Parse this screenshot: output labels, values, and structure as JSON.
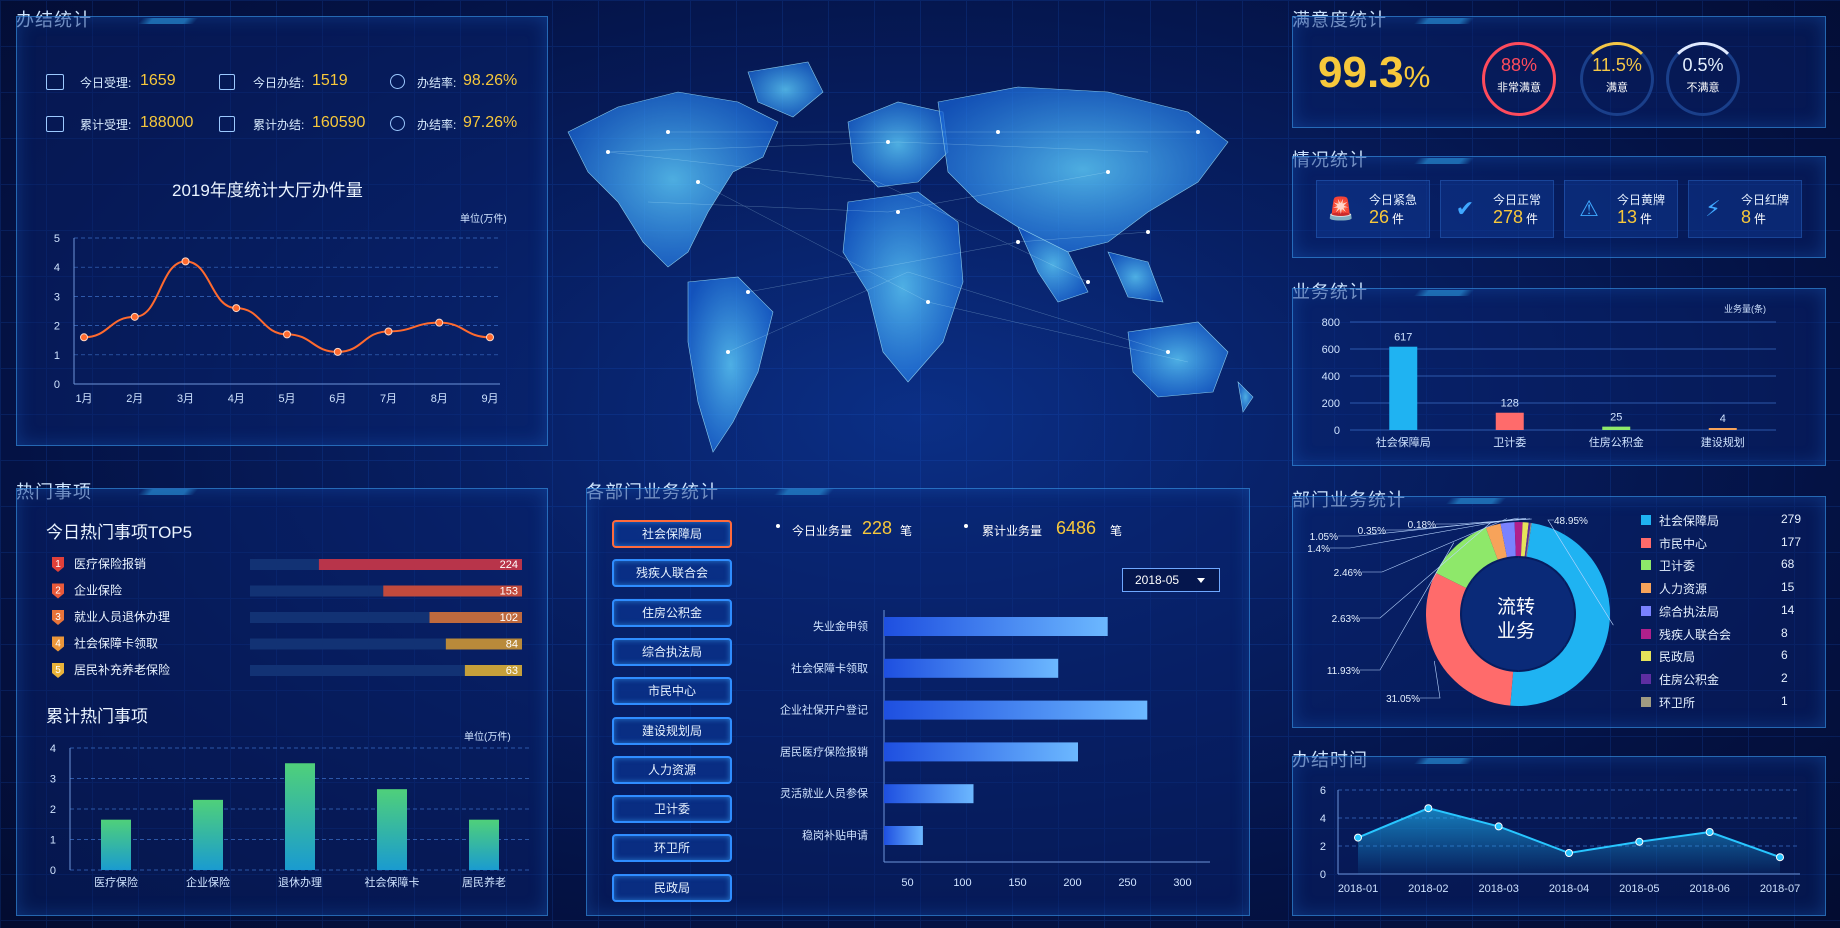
{
  "titles": {
    "banjie": "办结统计",
    "remen": "热门事项",
    "bumen_center": "各部门业务统计",
    "manyi": "满意度统计",
    "qingkuang": "情况统计",
    "yewu": "业务统计",
    "bumen_right": "部门业务统计",
    "banjie_time": "办结时间"
  },
  "banjie": {
    "row1": [
      {
        "label": "今日受理:",
        "value": "1659"
      },
      {
        "label": "今日办结:",
        "value": "1519"
      },
      {
        "label": "办结率:",
        "value": "98.26%"
      }
    ],
    "row2": [
      {
        "label": "累计受理:",
        "value": "188000"
      },
      {
        "label": "累计办结:",
        "value": "160590"
      },
      {
        "label": "办结率:",
        "value": "97.26%"
      }
    ],
    "chart_title": "2019年度统计大厅办件量",
    "unit": "单位(万件)"
  },
  "hot": {
    "today_title": "今日热门事项TOP5",
    "items": [
      {
        "rank": "1",
        "name": "医疗保险报销",
        "value": "224"
      },
      {
        "rank": "2",
        "name": "企业保险",
        "value": "153"
      },
      {
        "rank": "3",
        "name": "就业人员退休办理",
        "value": "102"
      },
      {
        "rank": "4",
        "name": "社会保障卡领取",
        "value": "84"
      },
      {
        "rank": "5",
        "name": "居民补充养老保险",
        "value": "63"
      }
    ],
    "rank_colors": [
      "#e0403a",
      "#e9593a",
      "#e8743a",
      "#eb963a",
      "#e9b33a"
    ],
    "bar_colors": [
      "#b8344a",
      "#c14a3d",
      "#bf6a3e",
      "#b98a3a",
      "#c6a03a"
    ],
    "cumulative_title": "累计热门事项",
    "unit": "单位(万件)"
  },
  "center": {
    "depts": [
      "社会保障局",
      "残疾人联合会",
      "住房公积金",
      "综合执法局",
      "市民中心",
      "建设规划局",
      "人力资源",
      "卫计委",
      "环卫所",
      "民政局"
    ],
    "today_label": "今日业务量",
    "today_value": "228",
    "today_unit": "笔",
    "total_label": "累计业务量",
    "total_value": "6486",
    "total_unit": "笔",
    "date_select": "2018-05"
  },
  "manyi": {
    "big": "99.3",
    "pct": "%",
    "rings": [
      {
        "value": "88%",
        "label": "非常满意",
        "color": "#ff4b5c"
      },
      {
        "value": "11.5%",
        "label": "满意",
        "color": "#f5c746"
      },
      {
        "value": "0.5%",
        "label": "不满意",
        "color": "#cfe3ff"
      }
    ]
  },
  "qingkuang": [
    {
      "label": "今日紧急",
      "value": "26",
      "unit": "件",
      "icon": "alarm-icon"
    },
    {
      "label": "今日正常",
      "value": "278",
      "unit": "件",
      "icon": "calendar-check-icon"
    },
    {
      "label": "今日黄牌",
      "value": "13",
      "unit": "件",
      "icon": "warning-icon"
    },
    {
      "label": "今日红牌",
      "value": "8",
      "unit": "件",
      "icon": "lightning-icon"
    }
  ],
  "yewu_unit": "业务量(条)",
  "donut": {
    "center_line1": "流转",
    "center_line2": "业务",
    "legend": [
      {
        "name": "社会保障局",
        "value": "279",
        "color": "#1fb3f2"
      },
      {
        "name": "市民中心",
        "value": "177",
        "color": "#ff6b6b"
      },
      {
        "name": "卫计委",
        "value": "68",
        "color": "#8ee86a"
      },
      {
        "name": "人力资源",
        "value": "15",
        "color": "#f7a35a"
      },
      {
        "name": "综合执法局",
        "value": "14",
        "color": "#7a82ff"
      },
      {
        "name": "残疾人联合会",
        "value": "8",
        "color": "#b0208c"
      },
      {
        "name": "民政局",
        "value": "6",
        "color": "#e6e35a"
      },
      {
        "name": "住房公积金",
        "value": "2",
        "color": "#5e2ea1"
      },
      {
        "name": "环卫所",
        "value": "1",
        "color": "#a09b82"
      }
    ],
    "pct_labels": [
      "48.95%",
      "31.05%",
      "11.93%",
      "2.63%",
      "2.46%",
      "1.4%",
      "1.05%",
      "0.35%",
      "0.18%"
    ]
  },
  "chart_data": [
    {
      "type": "line",
      "title": "2019年度统计大厅办件量",
      "ylabel": "单位(万件)",
      "x": [
        "1月",
        "2月",
        "3月",
        "4月",
        "5月",
        "6月",
        "7月",
        "8月",
        "9月"
      ],
      "values": [
        1.6,
        2.3,
        4.2,
        2.6,
        1.7,
        1.1,
        1.8,
        2.1,
        1.6
      ],
      "ylim": [
        0,
        5
      ],
      "yticks": [
        "0",
        "1",
        "2",
        "3",
        "4",
        "5"
      ],
      "color": "#ff6a2e"
    },
    {
      "type": "bar",
      "title": "今日热门事项TOP5",
      "categories": [
        "医疗保险报销",
        "企业保险",
        "就业人员退休办理",
        "社会保障卡领取",
        "居民补充养老保险"
      ],
      "values": [
        224,
        153,
        102,
        84,
        63
      ],
      "xlim": [
        0,
        300
      ]
    },
    {
      "type": "bar",
      "title": "累计热门事项",
      "ylabel": "单位(万件)",
      "categories": [
        "医疗保险",
        "企业保险",
        "退休办理",
        "社会保障卡",
        "居民养老"
      ],
      "values": [
        1.65,
        2.3,
        3.5,
        2.65,
        1.65
      ],
      "ylim": [
        0,
        4
      ],
      "yticks": [
        "0",
        "1",
        "2",
        "3",
        "4"
      ]
    },
    {
      "type": "bar",
      "title": "各部门业务统计",
      "categories": [
        "失业金申领",
        "社会保障卡领取",
        "企业社保开户登记",
        "居民医疗保险报销",
        "灵活就业人员参保",
        "稳岗补贴申请"
      ],
      "values": [
        232,
        187,
        268,
        205,
        110,
        64
      ],
      "xticks": [
        "50",
        "100",
        "150",
        "200",
        "250",
        "300"
      ],
      "xlim": [
        25,
        325
      ]
    },
    {
      "type": "bar",
      "title": "业务统计",
      "ylabel": "业务量(条)",
      "categories": [
        "社会保障局",
        "卫计委",
        "住房公积金",
        "建设规划"
      ],
      "values": [
        617,
        128,
        25,
        4
      ],
      "value_labels": [
        "617",
        "128",
        "25",
        "4"
      ],
      "colors": [
        "#1fb3f2",
        "#ff6b6b",
        "#8ee86a",
        "#f7a35a"
      ],
      "ylim": [
        0,
        800
      ],
      "yticks": [
        "0",
        "200",
        "400",
        "600",
        "800"
      ]
    },
    {
      "type": "pie",
      "title": "部门业务统计",
      "categories": [
        "社会保障局",
        "市民中心",
        "卫计委",
        "人力资源",
        "综合执法局",
        "残疾人联合会",
        "民政局",
        "住房公积金",
        "环卫所"
      ],
      "values": [
        48.95,
        31.05,
        11.93,
        2.63,
        2.46,
        1.4,
        1.05,
        0.35,
        0.18
      ]
    },
    {
      "type": "area",
      "title": "办结时间",
      "x": [
        "2018-01",
        "2018-02",
        "2018-03",
        "2018-04",
        "2018-05",
        "2018-06",
        "2018-07"
      ],
      "values": [
        2.6,
        4.7,
        3.4,
        1.5,
        2.3,
        3.0,
        1.2
      ],
      "ylim": [
        0,
        6
      ],
      "yticks": [
        "0",
        "2",
        "4",
        "6"
      ]
    }
  ]
}
